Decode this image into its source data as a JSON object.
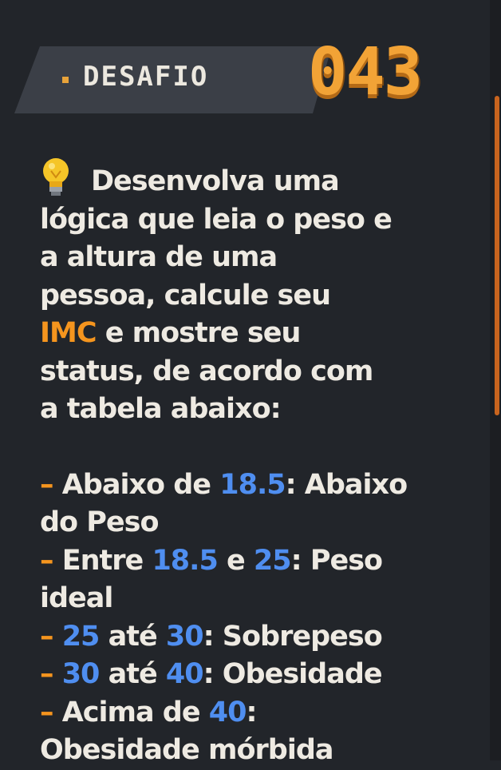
{
  "header": {
    "label": "DESAFIO",
    "number": "043"
  },
  "intro": {
    "line1": "Desenvolva uma",
    "line2": "lógica que leia o peso e",
    "line3": "a altura de uma",
    "line4": "pessoa, calcule seu",
    "highlight": "IMC",
    "line5_rest": "e mostre seu",
    "line6": "status, de acordo com",
    "line7": "a tabela abaixo:"
  },
  "table": {
    "dash": "–",
    "r1_text": "Abaixo de",
    "r1_num": "18.5",
    "r1_label": ": Abaixo",
    "r1_cont": "do Peso",
    "r2_text": "Entre",
    "r2_num1": "18.5",
    "r2_mid": "e",
    "r2_num2": "25",
    "r2_label": ": Peso",
    "r2_cont": "ideal",
    "r3_num1": "25",
    "r3_mid": "até",
    "r3_num2": "30",
    "r3_label": ": Sobrepeso",
    "r4_num1": "30",
    "r4_mid": "até",
    "r4_num2": "40",
    "r4_label": ": Obesidade",
    "r5_text": "Acima de",
    "r5_num": "40",
    "r5_label": ":",
    "r5_cont": "Obesidade mórbida"
  },
  "colors": {
    "background": "#22252a",
    "accent": "#f2a336",
    "number": "#4f8ef0",
    "text": "#eeeae2"
  },
  "icons": {
    "bulb": "lightbulb-icon"
  }
}
